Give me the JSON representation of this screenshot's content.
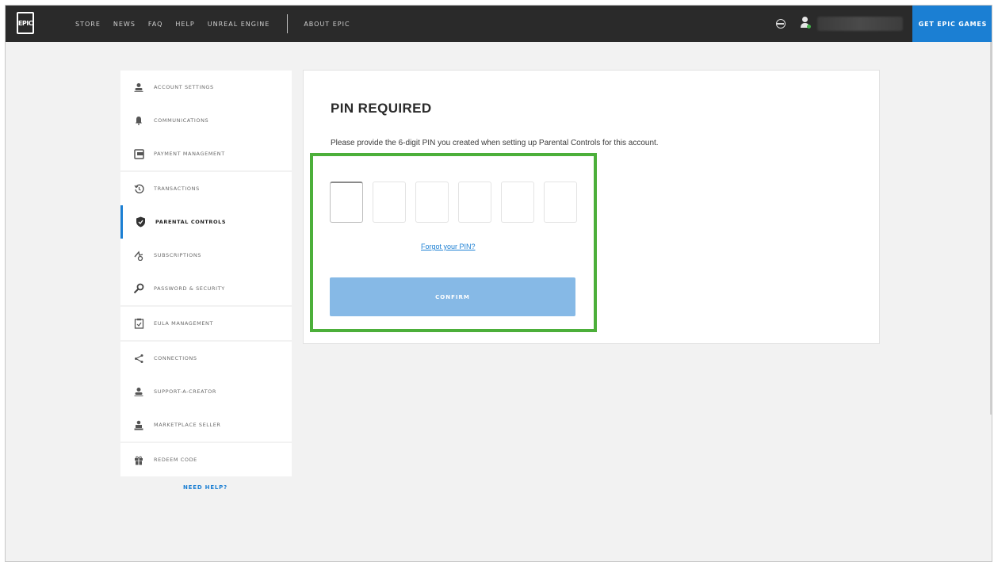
{
  "nav": {
    "logo": "EPIC",
    "links": [
      "STORE",
      "NEWS",
      "FAQ",
      "HELP",
      "UNREAL ENGINE"
    ],
    "about": "ABOUT EPIC",
    "get_epic": "GET EPIC GAMES"
  },
  "sidebar": {
    "groups": [
      [
        {
          "label": "ACCOUNT SETTINGS",
          "icon": "user-icon"
        },
        {
          "label": "COMMUNICATIONS",
          "icon": "bell-icon"
        },
        {
          "label": "PAYMENT MANAGEMENT",
          "icon": "wallet-icon"
        }
      ],
      [
        {
          "label": "TRANSACTIONS",
          "icon": "history-icon"
        },
        {
          "label": "PARENTAL CONTROLS",
          "icon": "shield-icon",
          "active": true
        },
        {
          "label": "SUBSCRIPTIONS",
          "icon": "subscriptions-icon"
        },
        {
          "label": "PASSWORD & SECURITY",
          "icon": "key-icon"
        }
      ],
      [
        {
          "label": "EULA MANAGEMENT",
          "icon": "clipboard-icon"
        }
      ],
      [
        {
          "label": "CONNECTIONS",
          "icon": "share-icon"
        },
        {
          "label": "SUPPORT-A-CREATOR",
          "icon": "creator-icon"
        },
        {
          "label": "MARKETPLACE SELLER",
          "icon": "seller-icon"
        }
      ],
      [
        {
          "label": "REDEEM CODE",
          "icon": "gift-icon"
        }
      ]
    ],
    "need_help": "NEED HELP?"
  },
  "main": {
    "title": "PIN REQUIRED",
    "description": "Please provide the 6-digit PIN you created when setting up Parental Controls for this account.",
    "pin": [
      "",
      "",
      "",
      "",
      "",
      ""
    ],
    "forgot": "Forgot your PIN?",
    "confirm": "CONFIRM"
  },
  "colors": {
    "nav_bg": "#2a2a2a",
    "accent": "#1b7fd3",
    "confirm_disabled": "#86b9e6",
    "highlight": "#4caf3a"
  }
}
